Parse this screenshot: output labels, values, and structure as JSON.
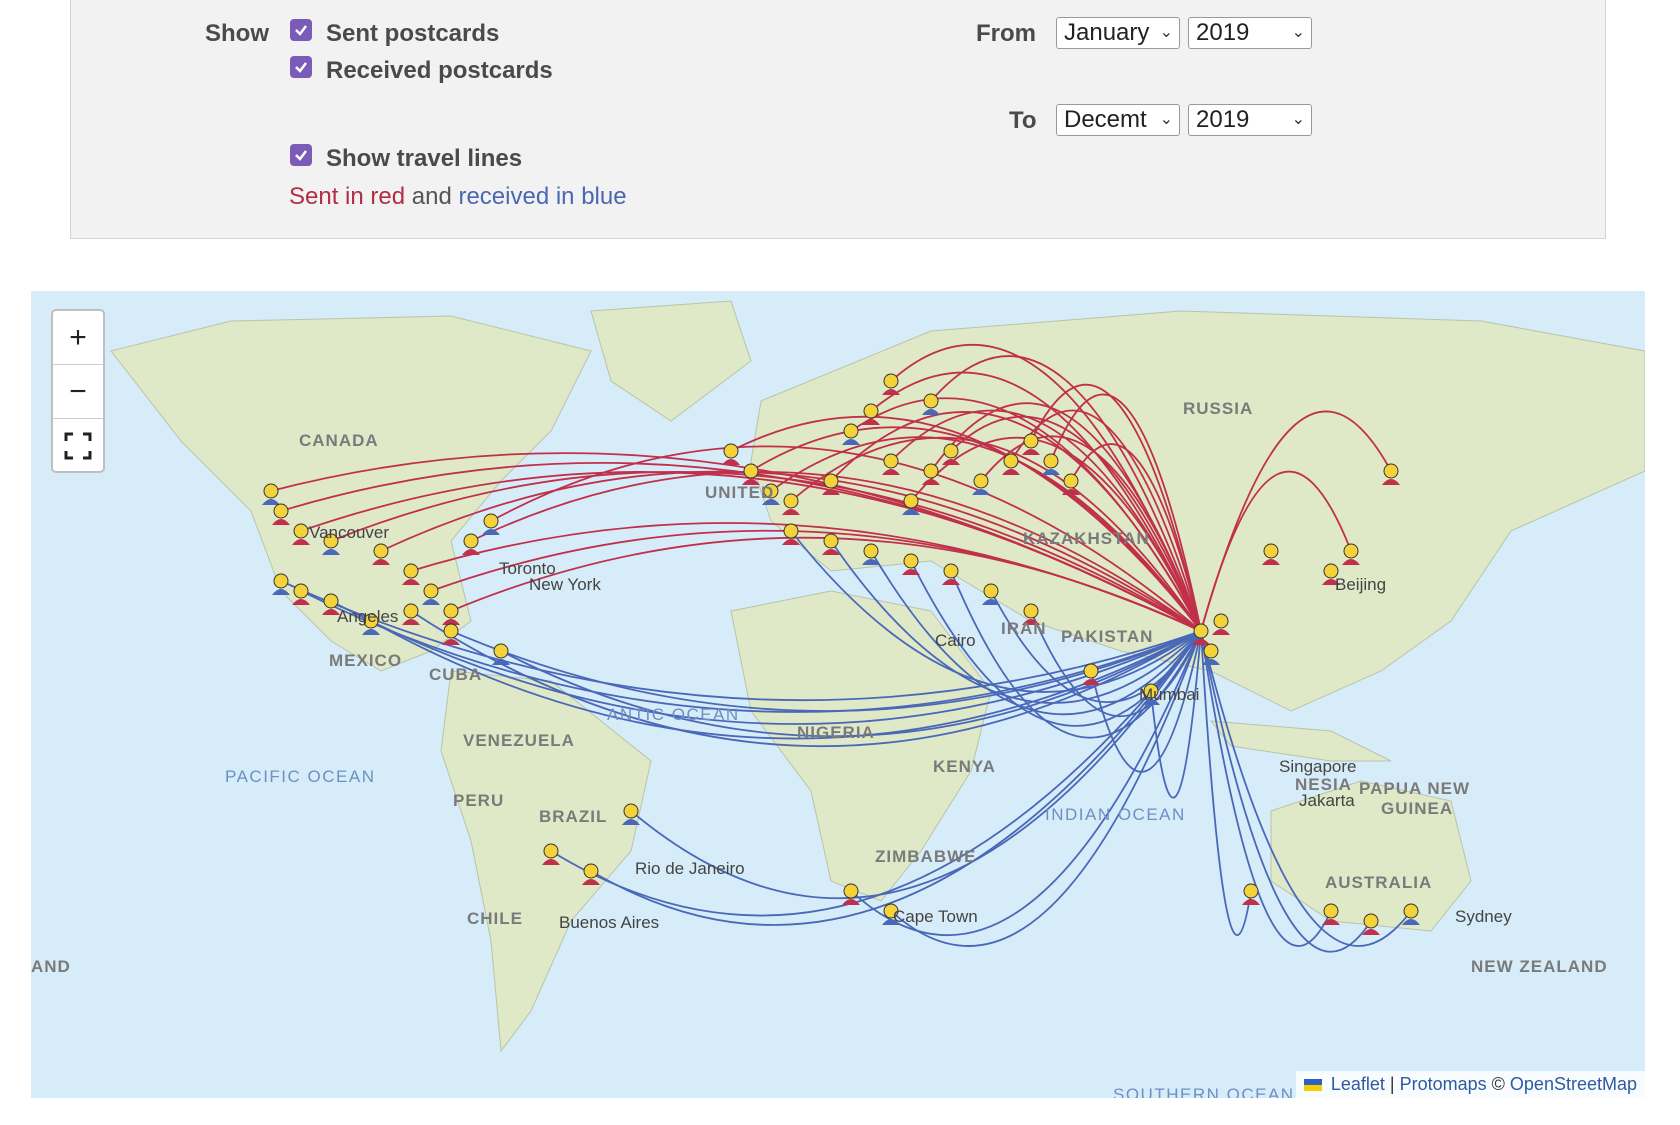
{
  "filters": {
    "show_label": "Show",
    "sent_postcards": "Sent postcards",
    "received_postcards": "Received postcards",
    "show_travel_lines": "Show travel lines",
    "legend": {
      "sent": "Sent in red",
      "and": "and",
      "received": "received in blue"
    },
    "from_label": "From",
    "to_label": "To",
    "from_month": "January",
    "from_year": "2019",
    "to_month": "Decemt",
    "to_year": "2019"
  },
  "colors": {
    "sent": "#c0304a",
    "received": "#4a68b8",
    "checkbox": "#7a5bb8"
  },
  "map": {
    "labels": {
      "canada": "CANADA",
      "russia": "RUSSIA",
      "united": "UNITED",
      "kazakhstan": "KAZAKHSTAN",
      "mexico": "MEXICO",
      "cuba": "CUBA",
      "venezuela": "VENEZUELA",
      "peru": "PERU",
      "brazil": "BRAZIL",
      "chile": "CHILE",
      "nigeria": "NIGERIA",
      "kenya": "KENYA",
      "zimbabwe": "ZIMBABWE",
      "iran": "IRAN",
      "pakistan": "PAKISTAN",
      "indonesia": "NESIA",
      "papua": "PAPUA NEW",
      "guinea": "GUINEA",
      "australia": "AUSTRALIA",
      "new_zealand": "NEW ZEALAND",
      "iceland_edge": "AND"
    },
    "oceans": {
      "pacific": "PACIFIC OCEAN",
      "atlantic": "ANTIC OCEAN",
      "indian": "INDIAN OCEAN",
      "southern": "SOUTHERN OCEAN"
    },
    "cities": {
      "vancouver": "Vancouver",
      "toronto": "Toronto",
      "new_york": "New York",
      "los_angeles": "Angeles",
      "beijing": "Beijing",
      "singapore": "Singapore",
      "jakarta": "Jakarta",
      "rio": "Rio de Janeiro",
      "buenos_aires": "Buenos Aires",
      "cape_town": "Cape Town",
      "sydney": "Sydney",
      "cairo": "Cairo",
      "mumbai": "Mumbai"
    },
    "attribution": {
      "leaflet": "Leaflet",
      "sep": "|",
      "protomaps": "Protomaps",
      "copyright": "©",
      "osm": "OpenStreetMap"
    }
  }
}
